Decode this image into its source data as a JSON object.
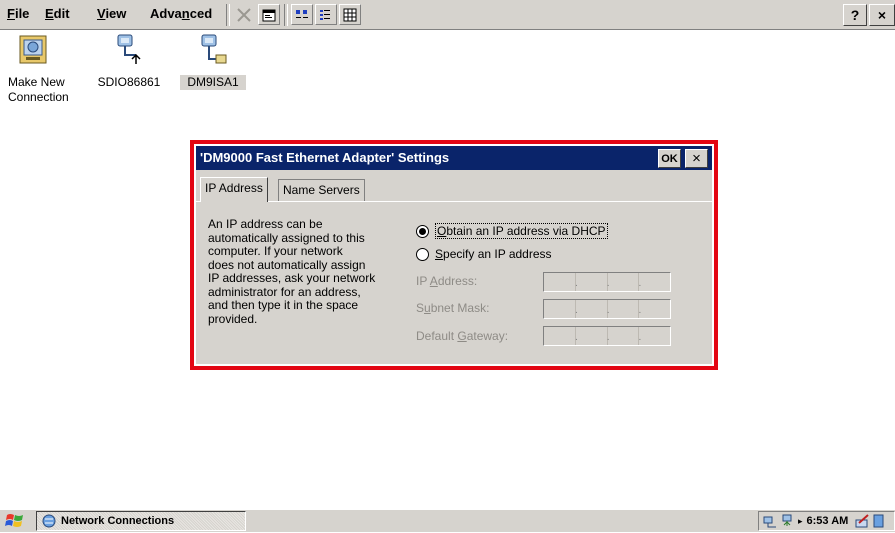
{
  "menubar": {
    "items": [
      {
        "label": "File",
        "key": "F",
        "rest": "ile"
      },
      {
        "label": "Edit",
        "key": "E",
        "rest": "dit"
      },
      {
        "label": "View",
        "key": "V",
        "rest": "iew"
      },
      {
        "label": "Advanced",
        "pre": "Adva",
        "key": "n",
        "rest": "ced"
      }
    ],
    "help_label": "?",
    "close_label": "×"
  },
  "desktop": {
    "icons": [
      {
        "label": "Make New\nConnection",
        "line1": "Make New",
        "line2": "Connection",
        "icon": "make-new-connection-icon"
      },
      {
        "label": "SDIO86861",
        "icon": "wireless-network-icon"
      },
      {
        "label": "DM9ISA1",
        "icon": "wired-network-icon",
        "selected": true
      }
    ]
  },
  "dialog": {
    "title": "'DM9000 Fast Ethernet Adapter' Settings",
    "ok_label": "OK",
    "close_label": "×",
    "tabs": [
      {
        "label": "IP Address",
        "active": true
      },
      {
        "label": "Name Servers",
        "active": false
      }
    ],
    "description": "An IP address can be automatically assigned to this computer.  If your network does not automatically assign IP addresses, ask your network administrator for an address, and then type it in the space provided.",
    "desc_lines": [
      "An IP address can be",
      "automatically assigned to this",
      "computer.  If your network",
      "does not automatically assign",
      "IP addresses, ask your network",
      "administrator for an address,",
      "and then type it in the space",
      "provided."
    ],
    "radio_dhcp": {
      "label": "Obtain an IP address via DHCP",
      "key": "O",
      "rest": "btain an IP address via DHCP",
      "selected": true
    },
    "radio_static": {
      "label": "Specify an IP address",
      "key": "S",
      "rest": "pecify an IP address",
      "selected": false
    },
    "fields": [
      {
        "label": "IP Address:",
        "pre": "IP ",
        "key": "A",
        "rest": "ddress:",
        "value": "...",
        "enabled": false
      },
      {
        "label": "Subnet Mask:",
        "pre": "S",
        "key": "u",
        "rest": "bnet Mask:",
        "value": "...",
        "enabled": false
      },
      {
        "label": "Default Gateway:",
        "pre": "Default ",
        "key": "G",
        "rest": "ateway:",
        "value": "...",
        "enabled": false
      }
    ]
  },
  "taskbar": {
    "task_label": "Network Connections",
    "clock": "6:53 AM"
  },
  "colors": {
    "titlebar": "#0a246a",
    "highlight": "#e30613",
    "face": "#d6d3ce"
  }
}
